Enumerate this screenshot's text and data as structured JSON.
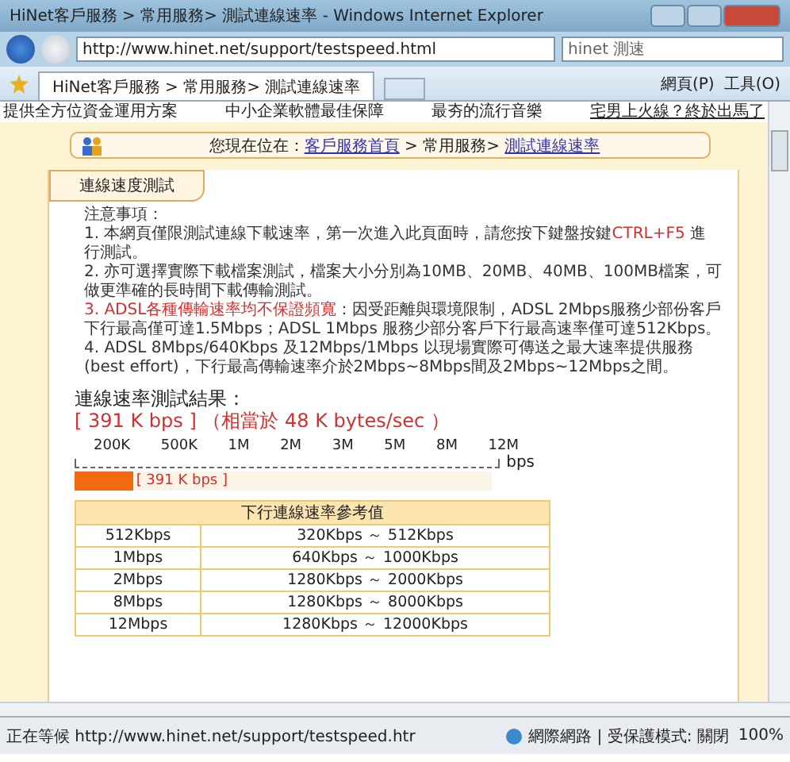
{
  "window": {
    "title": "HiNet客戶服務 > 常用服務> 測試連線速率 - Windows Internet Explorer"
  },
  "address_bar": {
    "url": "http://www.hinet.net/support/testspeed.html"
  },
  "search": {
    "value": "hinet 測速"
  },
  "tab": {
    "label": "HiNet客戶服務 > 常用服務> 測試連線速率"
  },
  "command_bar": {
    "page_menu": "網頁(P)",
    "tools_menu": "工具(O)"
  },
  "top_links": [
    "提供全方位資金運用方案",
    "中小企業軟體最佳保障",
    "最夯的流行音樂",
    "宅男上火線？終於出馬了"
  ],
  "breadcrumb": {
    "prefix": "您現在位在：",
    "items": [
      {
        "label": "客戶服務首頁",
        "link": true
      },
      {
        "label": "> 常用服務>",
        "link": false
      },
      {
        "label": "測試連線速率",
        "link": true
      }
    ]
  },
  "section_tab": "連線速度測試",
  "notes_title": "注意事項：",
  "notes": [
    {
      "segments": [
        {
          "text": "1. 本網頁僅限測試連線下載速率，第一次進入此頁面時，請您按下鍵盤按鍵",
          "red": false
        },
        {
          "text": "CTRL+F5",
          "red": true
        },
        {
          "text": " 進行測試。",
          "red": false
        }
      ]
    },
    {
      "segments": [
        {
          "text": "2. 亦可選擇實際下載檔案測試，檔案大小分別為10MB、20MB、40MB、100MB檔案，可做更準確的長時間下載傳輸測試。",
          "red": false
        }
      ]
    },
    {
      "segments": [
        {
          "text": "3. ADSL各種傳輸速率均不保證頻寬",
          "red": true
        },
        {
          "text": "：因受距離與環境限制，ADSL 2Mbps服務少部份客戶下行最高僅可達1.5Mbps；ADSL 1Mbps 服務少部分客戶下行最高速率僅可達512Kbps。",
          "red": false
        }
      ]
    },
    {
      "segments": [
        {
          "text": "4. ADSL 8Mbps/640Kbps 及12Mbps/1Mbps 以現場實際可傳送之最大速率提供服務(best effort)，下行最高傳輸速率介於2Mbps~8Mbps間及2Mbps~12Mbps之間。",
          "red": false
        }
      ]
    }
  ],
  "result": {
    "title": "連線速率測試結果：",
    "value": "[ 391 K bps ]",
    "equivalent": "（相當於 48 K bytes/sec ）"
  },
  "scale": {
    "ticks": [
      "200K",
      "500K",
      "1M",
      "2M",
      "3M",
      "5M",
      "8M",
      "12M"
    ],
    "unit": "bps",
    "level": 0.14,
    "bar_label": "[ 391 K bps ]"
  },
  "reference_table": {
    "title": "下行連線速率參考值",
    "rows": [
      [
        "512Kbps",
        "320Kbps ～ 512Kbps"
      ],
      [
        "1Mbps",
        "640Kbps ～ 1000Kbps"
      ],
      [
        "2Mbps",
        "1280Kbps ～ 2000Kbps"
      ],
      [
        "8Mbps",
        "1280Kbps ～ 8000Kbps"
      ],
      [
        "12Mbps",
        "1280Kbps ～ 12000Kbps"
      ]
    ]
  },
  "status_bar": {
    "text": "正在等候 http://www.hinet.net/support/testspeed.htr",
    "zone": "網際網路 | 受保護模式: 關閉",
    "zoom": "100%"
  }
}
